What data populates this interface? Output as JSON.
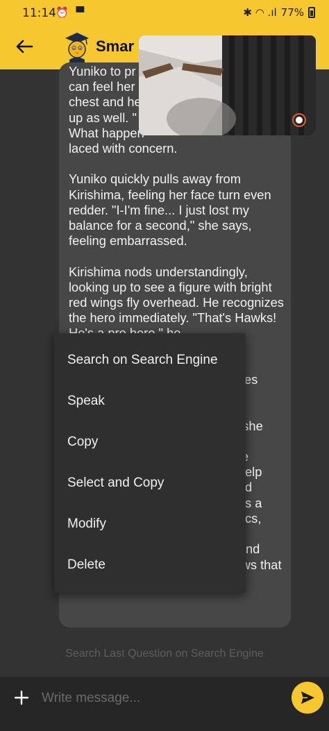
{
  "status_bar": {
    "time": "11:14",
    "left_icons": "⏰ ▀",
    "right_icons": "✱ ◠ .ıl",
    "battery_percent": "77%"
  },
  "app_bar": {
    "title": "Smar"
  },
  "message": {
    "text": "Yuniko to pr\ncan feel her\nchest and he\nup as well. \"\nWhat happen\nlaced with concern.\n\nYuniko quickly pulls away from Kirishima, feeling her face turn even redder. \"I-I'm fine... I just lost my balance for a second,\" she says, feeling embarrassed.\n\nKirishima nods understandingly, looking up to see a figure with bright red wings fly overhead. He recognizes the hero immediately. \"That's Hawks! He's a pro hero,\" he\n\n\n                                              sees\n                                              n,\n                                              s\n                                              ,\" she\n\n                                              the\n                                              t help\n                                              and\n                                              has a\n                                              roics,\n                                              he\n                                              . And\nwith Yuniko by his side, he knows that anything is possible."
  },
  "context_menu": {
    "items": [
      {
        "label": "Search on Search Engine"
      },
      {
        "label": "Speak"
      },
      {
        "label": "Copy"
      },
      {
        "label": "Select and Copy"
      },
      {
        "label": "Modify"
      },
      {
        "label": "Delete"
      }
    ]
  },
  "search_last_label": "Search Last Question on Search Engine",
  "input": {
    "placeholder": "Write message..."
  },
  "colors": {
    "accent": "#f7c72f",
    "background": "#333333",
    "bubble": "#474747",
    "menu": "#2f2f2f"
  },
  "icons": [
    "back-arrow-icon",
    "app-logo-icon",
    "more-vert-icon",
    "add-icon",
    "send-icon",
    "clock-icon",
    "wifi-icon",
    "signal-icon",
    "battery-icon",
    "bluetooth-icon",
    "alarm-icon",
    "message-icon"
  ]
}
